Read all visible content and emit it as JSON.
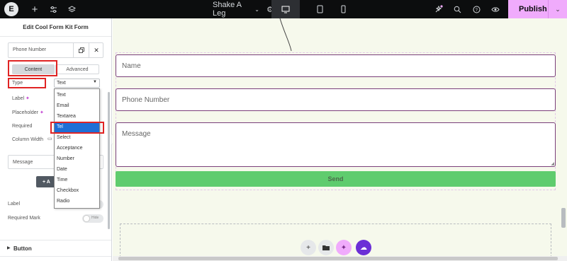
{
  "topbar": {
    "logo": "E",
    "add": "+",
    "page_title": "Shake A Leg",
    "publish_label": "Publish"
  },
  "panel": {
    "title": "Edit Cool Form Kit Form",
    "field_name": "Phone Number",
    "tab_content": "Content",
    "tab_advanced": "Advanced",
    "type_label": "Type",
    "type_value": "Text",
    "label_label": "Label",
    "placeholder_label": "Placeholder",
    "required_label": "Required",
    "column_width_label": "Column Width",
    "message_field": "Message",
    "add_item": "+ A",
    "label_toggle_label": "Label",
    "required_mark_label": "Required Mark",
    "required_mark_toggle": "Hide",
    "button_section": "Button",
    "type_options": [
      "Text",
      "Email",
      "Textarea",
      "Tel",
      "Select",
      "Acceptance",
      "Number",
      "Date",
      "Time",
      "Checkbox",
      "Radio"
    ],
    "type_selected": "Tel"
  },
  "canvas": {
    "name_placeholder": "Name",
    "phone_placeholder": "Phone Number",
    "message_placeholder": "Message",
    "send_label": "Send"
  },
  "colors": {
    "topbar_bg": "#0c0d0e",
    "publish_bg": "#f0abfc",
    "send_bg": "#5fcc6e",
    "highlight": "#e02424",
    "selected_option": "#1f6fd6"
  }
}
